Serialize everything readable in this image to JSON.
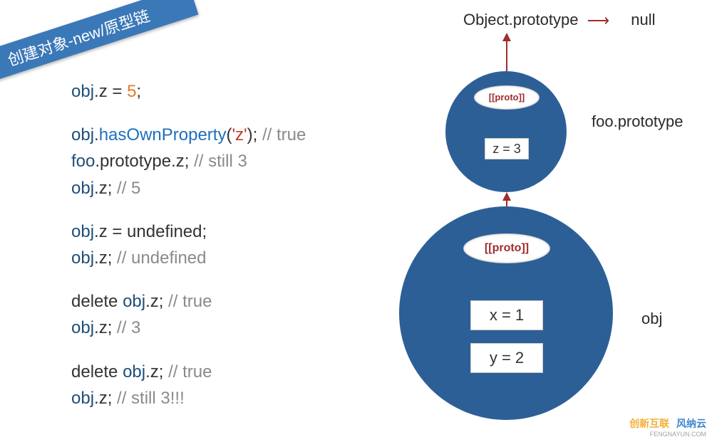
{
  "ribbon": "创建对象-new/原型链",
  "code": {
    "l1a": "obj",
    "l1b": ".z = ",
    "l1c": "5",
    "l1d": ";",
    "l2a": "obj",
    "l2b": ".",
    "l2c": "hasOwnProperty",
    "l2d": "(",
    "l2e": "'z'",
    "l2f": "); ",
    "l2g": "// true",
    "l3a": "foo",
    "l3b": ".prototype.z; ",
    "l3c": "// still 3",
    "l4a": "obj",
    "l4b": ".z; ",
    "l4c": "// 5",
    "l5a": "obj",
    "l5b": ".z = undefined;",
    "l6a": "obj",
    "l6b": ".z; ",
    "l6c": "// undefined",
    "l7a": "delete ",
    "l7b": "obj",
    "l7c": ".z; ",
    "l7d": "// true",
    "l8a": "obj",
    "l8b": ".z; ",
    "l8c": "// 3",
    "l9a": "delete ",
    "l9b": "obj",
    "l9c": ".z; ",
    "l9d": "// true",
    "l10a": "obj",
    "l10b": ".z; ",
    "l10c": "// still 3!!!"
  },
  "diagram": {
    "top_obj_proto": "Object.prototype",
    "top_null": "null",
    "proto_label": "[[proto]]",
    "foo_prototype_label": "foo.prototype",
    "z_box": "z = 3",
    "x_box": "x = 1",
    "y_box": "y = 2",
    "obj_label": "obj"
  },
  "chart_data": {
    "type": "diagram",
    "description": "JavaScript prototype chain illustration",
    "chain": [
      {
        "name": "null",
        "props": []
      },
      {
        "name": "Object.prototype",
        "props": [],
        "proto_points_to": "null"
      },
      {
        "name": "foo.prototype",
        "props": [
          {
            "key": "z",
            "value": 3
          }
        ],
        "proto_points_to": "Object.prototype"
      },
      {
        "name": "obj",
        "props": [
          {
            "key": "x",
            "value": 1
          },
          {
            "key": "y",
            "value": 2
          }
        ],
        "proto_points_to": "foo.prototype"
      }
    ]
  },
  "watermark": {
    "a": "创新互联",
    "b": "风纳云",
    "c": "FENGNAYUN.COM"
  }
}
